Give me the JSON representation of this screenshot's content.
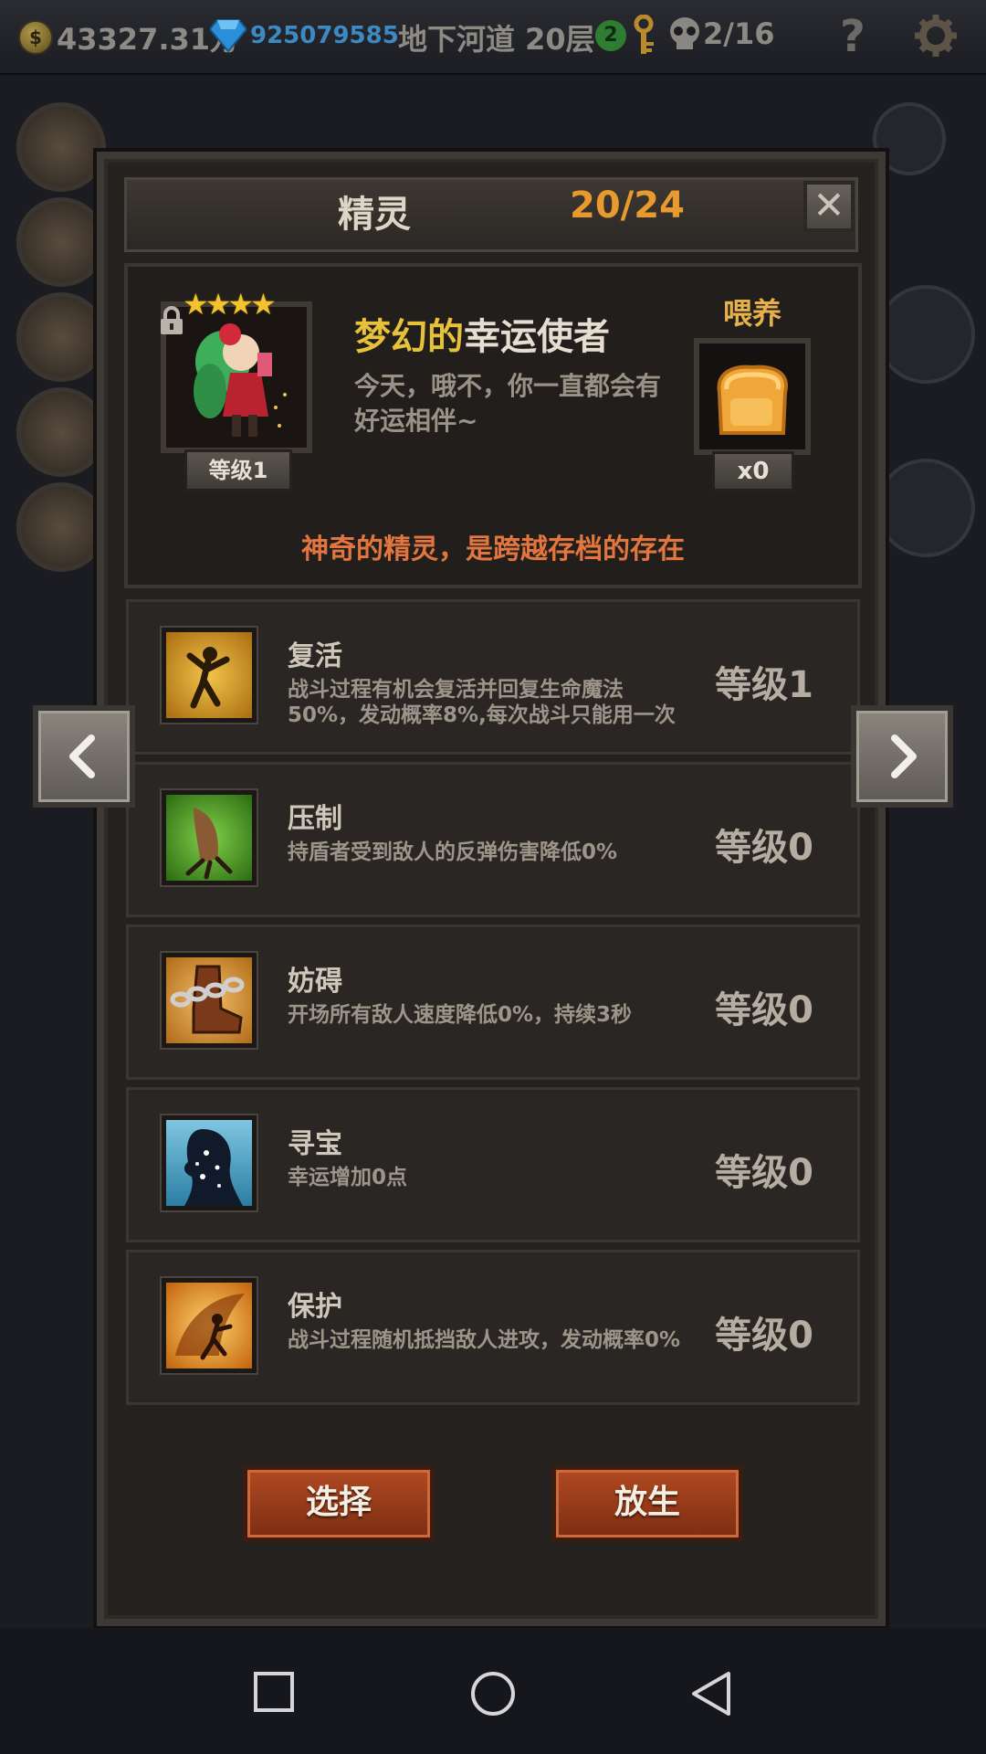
{
  "status_bar": {
    "gold": "43327.31万",
    "gems": "925079585",
    "floor": "地下河道 20层",
    "keys": "2",
    "skulls": "2/16",
    "help": "?"
  },
  "dialog": {
    "title": "精灵",
    "count": "20/24",
    "close_label": "✕"
  },
  "spirit": {
    "name_prefix": "梦幻的",
    "name_suffix": "幸运使者",
    "stars": "★★★★",
    "level": "等级1",
    "description": "今天，哦不，你一直都会有好运相伴~",
    "feed_label": "喂养",
    "feed_count": "x0",
    "notice": "神奇的精灵，是跨越存档的存在"
  },
  "skills": [
    {
      "name": "复活",
      "desc": "战斗过程有机会复活并回复生命魔法50%，发动概率8%,每次战斗只能用一次",
      "level": "等级1",
      "icon": "dancer-icon"
    },
    {
      "name": "压制",
      "desc": "持盾者受到敌人的反弹伤害降低0%",
      "level": "等级0",
      "icon": "claw-icon"
    },
    {
      "name": "妨碍",
      "desc": "开场所有敌人速度降低0%，持续3秒",
      "level": "等级0",
      "icon": "chained-boot-icon"
    },
    {
      "name": "寻宝",
      "desc": "幸运增加0点",
      "level": "等级0",
      "icon": "sparkle-silhouette-icon"
    },
    {
      "name": "保护",
      "desc": "战斗过程随机抵挡敌人进攻，发动概率0%",
      "level": "等级0",
      "icon": "fairy-icon"
    }
  ],
  "buttons": {
    "select": "选择",
    "release": "放生"
  },
  "colors": {
    "accent_orange": "#e99a2e",
    "name_gold": "#e7c13a",
    "notice": "#e3763f",
    "button_red": "#a8431f"
  }
}
